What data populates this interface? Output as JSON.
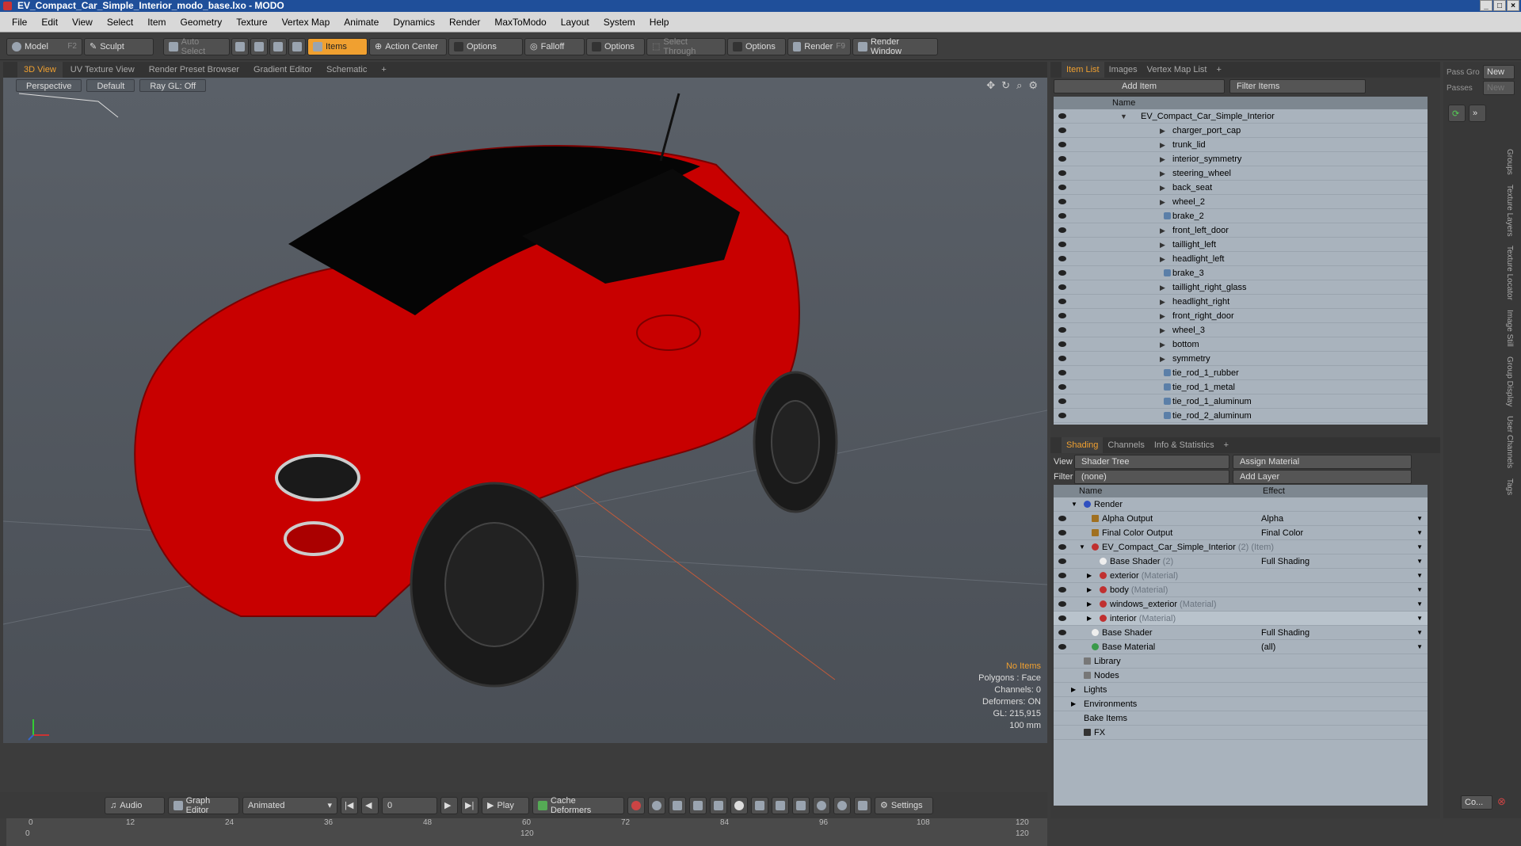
{
  "window": {
    "title": "EV_Compact_Car_Simple_Interior_modo_base.lxo - MODO"
  },
  "menu": [
    "File",
    "Edit",
    "View",
    "Select",
    "Item",
    "Geometry",
    "Texture",
    "Vertex Map",
    "Animate",
    "Dynamics",
    "Render",
    "MaxToModo",
    "Layout",
    "System",
    "Help"
  ],
  "toolbar": {
    "model": "Model",
    "model_key": "F2",
    "sculpt": "Sculpt",
    "auto_select": "Auto Select",
    "items": "Items",
    "action_center": "Action Center",
    "options1": "Options",
    "falloff": "Falloff",
    "options2": "Options",
    "select_through": "Select Through",
    "options3": "Options",
    "render": "Render",
    "render_key": "F9",
    "render_window": "Render Window"
  },
  "viewport_tabs": [
    "3D View",
    "UV Texture View",
    "Render Preset Browser",
    "Gradient Editor",
    "Schematic",
    "+"
  ],
  "viewport": {
    "perspective": "Perspective",
    "default": "Default",
    "raygl": "Ray GL: Off",
    "stats": {
      "no_items": "No Items",
      "polygons": "Polygons : Face",
      "channels": "Channels: 0",
      "deformers": "Deformers: ON",
      "gl": "GL: 215,915",
      "scale": "100 mm"
    }
  },
  "timeline": {
    "ticks": [
      "0",
      "12",
      "24",
      "36",
      "48",
      "60",
      "72",
      "84",
      "96",
      "108",
      "120"
    ],
    "low": [
      "0",
      "120",
      "120"
    ]
  },
  "bottombar": {
    "audio": "Audio",
    "graph_editor": "Graph Editor",
    "animated": "Animated",
    "frame": "0",
    "play": "Play",
    "cache": "Cache Deformers",
    "settings": "Settings"
  },
  "item_tabs": [
    "Item List",
    "Images",
    "Vertex Map List",
    "+"
  ],
  "item_list": {
    "add_item": "Add Item",
    "filter": "Filter Items",
    "col_name": "Name",
    "root": "EV_Compact_Car_Simple_Interior",
    "items": [
      "charger_port_cap",
      "trunk_lid",
      "interior_symmetry",
      "steering_wheel",
      "back_seat",
      "wheel_2",
      "brake_2",
      "front_left_door",
      "taillight_left",
      "headlight_left",
      "brake_3",
      "taillight_right_glass",
      "headlight_right",
      "front_right_door",
      "wheel_3",
      "bottom",
      "symmetry",
      "tie_rod_1_rubber",
      "tie_rod_1_metal",
      "tie_rod_1_aluminum",
      "tie_rod_2_aluminum"
    ]
  },
  "shading_tabs": [
    "Shading",
    "Channels",
    "Info & Statistics",
    "+"
  ],
  "shading": {
    "view_label": "View",
    "view_value": "Shader Tree",
    "assign": "Assign Material",
    "filter_label": "Filter",
    "filter_value": "(none)",
    "add_layer": "Add Layer",
    "col_name": "Name",
    "col_effect": "Effect",
    "rows": [
      {
        "name": "Render",
        "sub": "",
        "effect": ""
      },
      {
        "name": "Alpha Output",
        "sub": "",
        "effect": "Alpha"
      },
      {
        "name": "Final Color Output",
        "sub": "",
        "effect": "Final Color"
      },
      {
        "name": "EV_Compact_Car_Simple_Interior",
        "sub": "(2) (Item)",
        "effect": ""
      },
      {
        "name": "Base Shader",
        "sub": "(2)",
        "effect": "Full Shading"
      },
      {
        "name": "exterior",
        "sub": "(Material)",
        "effect": ""
      },
      {
        "name": "body",
        "sub": "(Material)",
        "effect": ""
      },
      {
        "name": "windows_exterior",
        "sub": "(Material)",
        "effect": ""
      },
      {
        "name": "interior",
        "sub": "(Material)",
        "effect": ""
      },
      {
        "name": "Base Shader",
        "sub": "",
        "effect": "Full Shading"
      },
      {
        "name": "Base Material",
        "sub": "",
        "effect": "(all)"
      },
      {
        "name": "Library",
        "sub": "",
        "effect": ""
      },
      {
        "name": "Nodes",
        "sub": "",
        "effect": ""
      },
      {
        "name": "Lights",
        "sub": "",
        "effect": ""
      },
      {
        "name": "Environments",
        "sub": "",
        "effect": ""
      },
      {
        "name": "Bake Items",
        "sub": "",
        "effect": ""
      },
      {
        "name": "FX",
        "sub": "",
        "effect": ""
      }
    ]
  },
  "far_right": {
    "pass_group": "Pass Gro",
    "new1": "New",
    "passes": "Passes",
    "new2": "New",
    "vertical": [
      "Groups",
      "Texture Layers",
      "Texture Locator",
      "Image Still",
      "Group Display",
      "User Channels",
      "Tags"
    ],
    "co": "Co..."
  }
}
